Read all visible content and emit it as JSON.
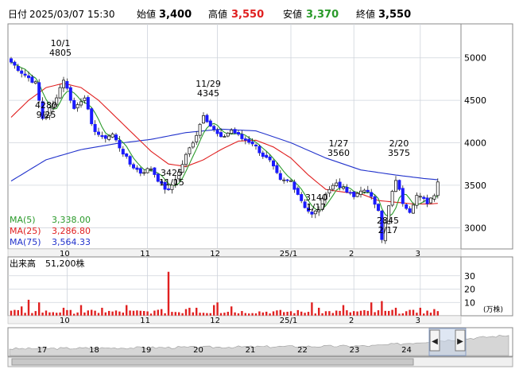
{
  "header": {
    "date_label": "日付",
    "date": "2025/03/07 15:30",
    "open_label": "始値",
    "open": "3,400",
    "high_label": "高値",
    "high": "3,550",
    "low_label": "安値",
    "low": "3,370",
    "close_label": "終値",
    "close": "3,550"
  },
  "colors": {
    "up": "#e02020",
    "down": "#1a1aff",
    "ma5": "#2a9a2a",
    "ma25": "#e02020",
    "ma75": "#2233cc",
    "grid": "#cfd4dc",
    "frame": "#888888",
    "volume": "#e02020",
    "navigator_fill": "#d6d6d6"
  },
  "legend": {
    "ma5_label": "MA(5)",
    "ma5_value": "3,338.00",
    "ma25_label": "MA(25)",
    "ma25_value": "3,286.80",
    "ma75_label": "MA(75)",
    "ma75_value": "3,564.33"
  },
  "volume_panel": {
    "label": "出来高",
    "value": "51,200株",
    "unit": "(万株)",
    "yticks": [
      "30",
      "20",
      "10"
    ]
  },
  "month_labels": [
    "10",
    "11",
    "12",
    "25/1",
    "2",
    "3"
  ],
  "navigator": {
    "labels": [
      "17",
      "18",
      "19",
      "20",
      "21",
      "22",
      "23",
      "24"
    ],
    "left_arrow": "◀",
    "right_arrow": "▶"
  },
  "chart_data": {
    "type": "candlestick",
    "y_axis": {
      "ticks": [
        3000,
        3500,
        4000,
        4500,
        5000
      ],
      "range": [
        2750,
        5400
      ]
    },
    "annotations": [
      {
        "date": "10/1",
        "value": "4805"
      },
      {
        "date": "9/25",
        "value": "4280"
      },
      {
        "date": "11/15",
        "value": "3425"
      },
      {
        "date": "11/29",
        "value": "4345"
      },
      {
        "date": "1/17",
        "value": "3140"
      },
      {
        "date": "1/27",
        "value": "3560"
      },
      {
        "date": "2/17",
        "value": "2845"
      },
      {
        "date": "2/20",
        "value": "3575"
      }
    ],
    "month_starts": [
      {
        "label": "10",
        "index": 16
      },
      {
        "label": "11",
        "index": 39
      },
      {
        "label": "12",
        "index": 59
      },
      {
        "label": "25/1",
        "index": 80
      },
      {
        "label": "2",
        "index": 98
      },
      {
        "label": "3",
        "index": 117
      }
    ],
    "anchors_close": [
      [
        0,
        4950
      ],
      [
        3,
        4830
      ],
      [
        7,
        4700
      ],
      [
        9,
        4290
      ],
      [
        12,
        4450
      ],
      [
        15,
        4750
      ],
      [
        18,
        4400
      ],
      [
        21,
        4550
      ],
      [
        23,
        4200
      ],
      [
        26,
        4050
      ],
      [
        29,
        4100
      ],
      [
        31,
        3950
      ],
      [
        34,
        3750
      ],
      [
        37,
        3650
      ],
      [
        40,
        3700
      ],
      [
        43,
        3500
      ],
      [
        45,
        3430
      ],
      [
        48,
        3650
      ],
      [
        50,
        3850
      ],
      [
        53,
        4100
      ],
      [
        55,
        4340
      ],
      [
        57,
        4200
      ],
      [
        60,
        4050
      ],
      [
        63,
        4150
      ],
      [
        66,
        4050
      ],
      [
        69,
        4000
      ],
      [
        72,
        3850
      ],
      [
        74,
        3780
      ],
      [
        77,
        3550
      ],
      [
        80,
        3550
      ],
      [
        82,
        3400
      ],
      [
        84,
        3250
      ],
      [
        86,
        3150
      ],
      [
        88,
        3220
      ],
      [
        90,
        3420
      ],
      [
        93,
        3530
      ],
      [
        96,
        3420
      ],
      [
        98,
        3360
      ],
      [
        100,
        3450
      ],
      [
        103,
        3380
      ],
      [
        105,
        3220
      ],
      [
        106,
        2850
      ],
      [
        108,
        3250
      ],
      [
        110,
        3570
      ],
      [
        112,
        3300
      ],
      [
        114,
        3200
      ],
      [
        116,
        3380
      ],
      [
        119,
        3300
      ],
      [
        121,
        3400
      ],
      [
        122,
        3550
      ]
    ],
    "ma25_anchors": [
      [
        0,
        4300
      ],
      [
        5,
        4500
      ],
      [
        10,
        4650
      ],
      [
        15,
        4700
      ],
      [
        20,
        4650
      ],
      [
        25,
        4500
      ],
      [
        30,
        4300
      ],
      [
        35,
        4100
      ],
      [
        40,
        3900
      ],
      [
        45,
        3750
      ],
      [
        50,
        3720
      ],
      [
        55,
        3800
      ],
      [
        60,
        3920
      ],
      [
        65,
        4020
      ],
      [
        70,
        4030
      ],
      [
        75,
        3950
      ],
      [
        80,
        3820
      ],
      [
        85,
        3620
      ],
      [
        90,
        3450
      ],
      [
        95,
        3420
      ],
      [
        100,
        3400
      ],
      [
        105,
        3320
      ],
      [
        110,
        3300
      ],
      [
        115,
        3280
      ],
      [
        120,
        3280
      ],
      [
        122,
        3287
      ]
    ],
    "ma75_anchors": [
      [
        0,
        3550
      ],
      [
        10,
        3800
      ],
      [
        20,
        3920
      ],
      [
        30,
        3990
      ],
      [
        40,
        4040
      ],
      [
        50,
        4120
      ],
      [
        60,
        4160
      ],
      [
        70,
        4140
      ],
      [
        80,
        4000
      ],
      [
        90,
        3820
      ],
      [
        100,
        3680
      ],
      [
        110,
        3620
      ],
      [
        118,
        3580
      ],
      [
        122,
        3564
      ]
    ],
    "volume_spikes": [
      [
        3,
        7
      ],
      [
        5,
        12
      ],
      [
        8,
        10
      ],
      [
        15,
        6
      ],
      [
        20,
        8
      ],
      [
        26,
        6
      ],
      [
        33,
        8
      ],
      [
        43,
        5
      ],
      [
        45,
        33
      ],
      [
        50,
        5
      ],
      [
        51,
        6
      ],
      [
        53,
        6
      ],
      [
        58,
        8
      ],
      [
        59,
        10
      ],
      [
        63,
        7
      ],
      [
        86,
        10
      ],
      [
        88,
        6
      ],
      [
        95,
        8
      ],
      [
        103,
        10
      ],
      [
        106,
        11
      ],
      [
        110,
        6
      ],
      [
        117,
        6
      ],
      [
        121,
        5
      ]
    ],
    "volume_range": [
      0,
      40
    ]
  }
}
